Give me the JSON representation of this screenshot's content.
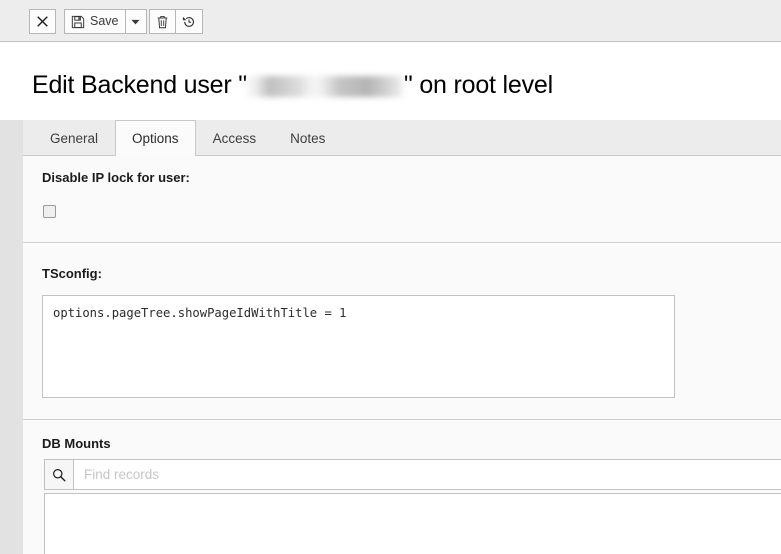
{
  "toolbar": {
    "close_label": "✕",
    "close_icon": "close-icon",
    "save_label": "Save",
    "save_icon": "floppy-disk-icon",
    "caret_icon": "chevron-down-icon",
    "delete_icon": "trash-icon",
    "history_icon": "history-undo-icon"
  },
  "header": {
    "title_prefix": "Edit Backend user \"",
    "username_redacted": "redacted",
    "title_suffix": "\" on root level"
  },
  "tabs": [
    {
      "label": "General",
      "active": false
    },
    {
      "label": "Options",
      "active": true
    },
    {
      "label": "Access",
      "active": false
    },
    {
      "label": "Notes",
      "active": false
    }
  ],
  "fields": {
    "ip_lock": {
      "label": "Disable IP lock for user:",
      "checked": false
    },
    "tsconfig": {
      "label": "TSconfig:",
      "value": "options.pageTree.showPageIdWithTitle = 1"
    },
    "db_mounts": {
      "label": "DB Mounts",
      "search_icon": "search-icon",
      "search_placeholder": "Find records",
      "search_value": ""
    }
  },
  "colors": {
    "toolbar_bg": "#ededed",
    "tabbar_bg": "#ececec",
    "panel_bg": "#fafafa",
    "active_tab_bg": "#fbfbfb",
    "border": "#c8c8c8",
    "text": "#1b1b1b"
  }
}
